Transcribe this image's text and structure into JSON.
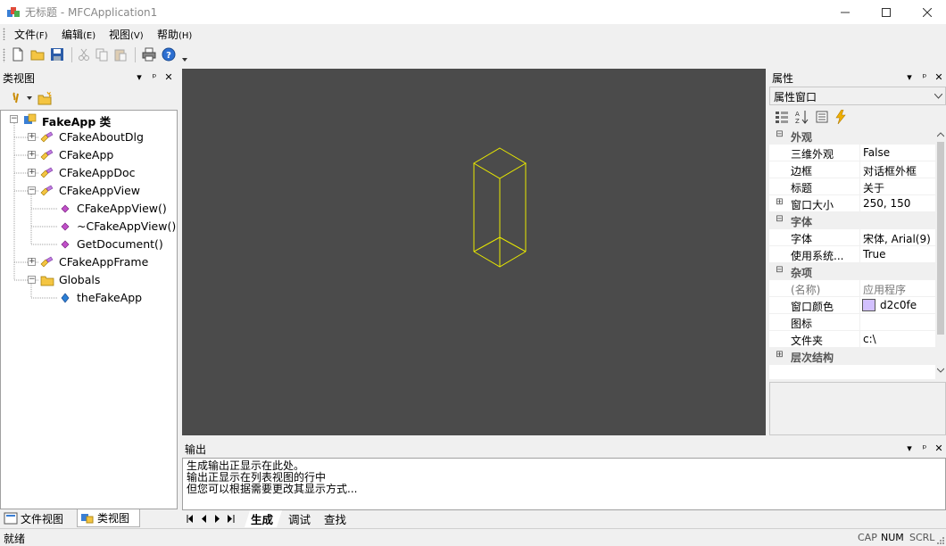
{
  "window": {
    "title": "无标题 - MFCApplication1"
  },
  "menu": [
    {
      "label": "文件",
      "accel": "(F)"
    },
    {
      "label": "编辑",
      "accel": "(E)"
    },
    {
      "label": "视图",
      "accel": "(V)"
    },
    {
      "label": "帮助",
      "accel": "(H)"
    }
  ],
  "toolbar": {
    "icons": [
      "new-icon",
      "open-icon",
      "save-icon",
      "cut-icon",
      "copy-icon",
      "paste-icon",
      "print-icon",
      "help-icon"
    ]
  },
  "class_view": {
    "title": "类视图",
    "tree": [
      {
        "label": "FakeApp 类",
        "level": 0,
        "bold": true,
        "icon": "class-root-icon"
      },
      {
        "label": "CFakeAboutDlg",
        "level": 1,
        "icon": "class-icon"
      },
      {
        "label": "CFakeApp",
        "level": 1,
        "icon": "class-icon"
      },
      {
        "label": "CFakeAppDoc",
        "level": 1,
        "icon": "class-icon"
      },
      {
        "label": "CFakeAppView",
        "level": 1,
        "icon": "class-icon",
        "expanded": true
      },
      {
        "label": "CFakeAppView()",
        "level": 2,
        "icon": "method-icon"
      },
      {
        "label": "~CFakeAppView()",
        "level": 2,
        "icon": "method-icon"
      },
      {
        "label": "GetDocument()",
        "level": 2,
        "icon": "method-icon"
      },
      {
        "label": "CFakeAppFrame",
        "level": 1,
        "icon": "class-icon"
      },
      {
        "label": "Globals",
        "level": 1,
        "icon": "folder-icon",
        "expanded": true
      },
      {
        "label": "theFakeApp",
        "level": 2,
        "icon": "variable-icon"
      }
    ],
    "tabs": [
      "文件视图",
      "类视图"
    ]
  },
  "properties": {
    "title": "属性",
    "combo": "属性窗口",
    "rows": [
      {
        "type": "category",
        "name": "外观",
        "sign": "⊟"
      },
      {
        "name": "三维外观",
        "value": "False"
      },
      {
        "name": "边框",
        "value": "对话框外框"
      },
      {
        "name": "标题",
        "value": "关于"
      },
      {
        "name": "窗口大小",
        "value": "250, 150",
        "sign": "⊞"
      },
      {
        "type": "category",
        "name": "字体",
        "sign": "⊟"
      },
      {
        "name": "字体",
        "value": "宋体, Arial(9)"
      },
      {
        "name": "使用系统...",
        "value": "True"
      },
      {
        "type": "category",
        "name": "杂项",
        "sign": "⊟"
      },
      {
        "name": "(名称)",
        "value": "应用程序",
        "disabled": true
      },
      {
        "name": "窗口颜色",
        "value": "d2c0fe",
        "swatch": "#d2c0fe"
      },
      {
        "name": "图标",
        "value": ""
      },
      {
        "name": "文件夹",
        "value": "c:\\"
      },
      {
        "type": "category",
        "name": "层次结构",
        "sign": "⊞"
      }
    ]
  },
  "output": {
    "title": "输出",
    "lines": [
      "生成输出正显示在此处。",
      "输出正显示在列表视图的行中",
      "但您可以根据需要更改其显示方式..."
    ],
    "tabs": [
      "生成",
      "调试",
      "查找"
    ]
  },
  "status": {
    "text": "就绪",
    "indicators": [
      "CAP",
      "NUM",
      "SCRL"
    ]
  },
  "colors": {
    "viewport_bg": "#4b4b4b",
    "wireframe": "#e8e800",
    "window_color_swatch": "#d2c0fe"
  }
}
